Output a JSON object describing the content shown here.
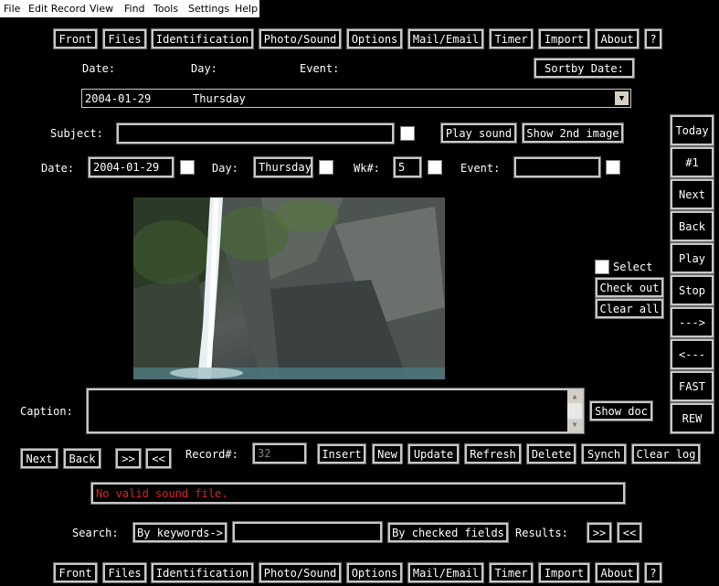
{
  "menu": [
    "File",
    "Edit Record",
    "View",
    "Find",
    "Tools",
    "Settings",
    "Help"
  ],
  "nav_buttons": [
    "Front",
    "Files",
    "Identification",
    "Photo/Sound",
    "Options",
    "Mail/Email",
    "Timer",
    "Import",
    "About",
    "?"
  ],
  "header": {
    "date_label": "Date:",
    "day_label": "Day:",
    "event_label": "Event:",
    "sortby_label": "Sortby Date:"
  },
  "record_select": {
    "date": "2004-01-29",
    "day": "Thursday"
  },
  "subject": {
    "label": "Subject:",
    "value": "",
    "play_sound": "Play sound",
    "show_2nd_image": "Show 2nd image"
  },
  "fields": {
    "date_label": "Date:",
    "date_value": "2004-01-29",
    "day_label": "Day:",
    "day_value": "Thursday",
    "wk_label": "Wk#:",
    "wk_value": "5",
    "event_label": "Event:",
    "event_value": ""
  },
  "side_buttons": [
    "Today",
    "#1",
    "Next",
    "Back",
    "Play",
    "Stop",
    "--->",
    "<---",
    "FAST",
    "REW"
  ],
  "selection": {
    "select_label": "Select",
    "check_out": "Check out",
    "clear_all": "Clear all"
  },
  "caption": {
    "label": "Caption:",
    "value": "",
    "show_doc": "Show doc"
  },
  "record_bar": {
    "next": "Next",
    "back": "Back",
    "forward": ">>",
    "rewind": "<<",
    "record_label": "Record#:",
    "record_value": "32",
    "insert": "Insert",
    "new": "New",
    "update": "Update",
    "refresh": "Refresh",
    "delete": "Delete",
    "synch": "Synch",
    "clear_log": "Clear log"
  },
  "status": {
    "message": "No valid sound file.",
    "color": "#e02020"
  },
  "search": {
    "label": "Search:",
    "by_keywords": "By keywords->",
    "query": "",
    "by_checked_fields": "By checked fields",
    "results_label": "Results:",
    "next": ">>",
    "prev": "<<"
  }
}
